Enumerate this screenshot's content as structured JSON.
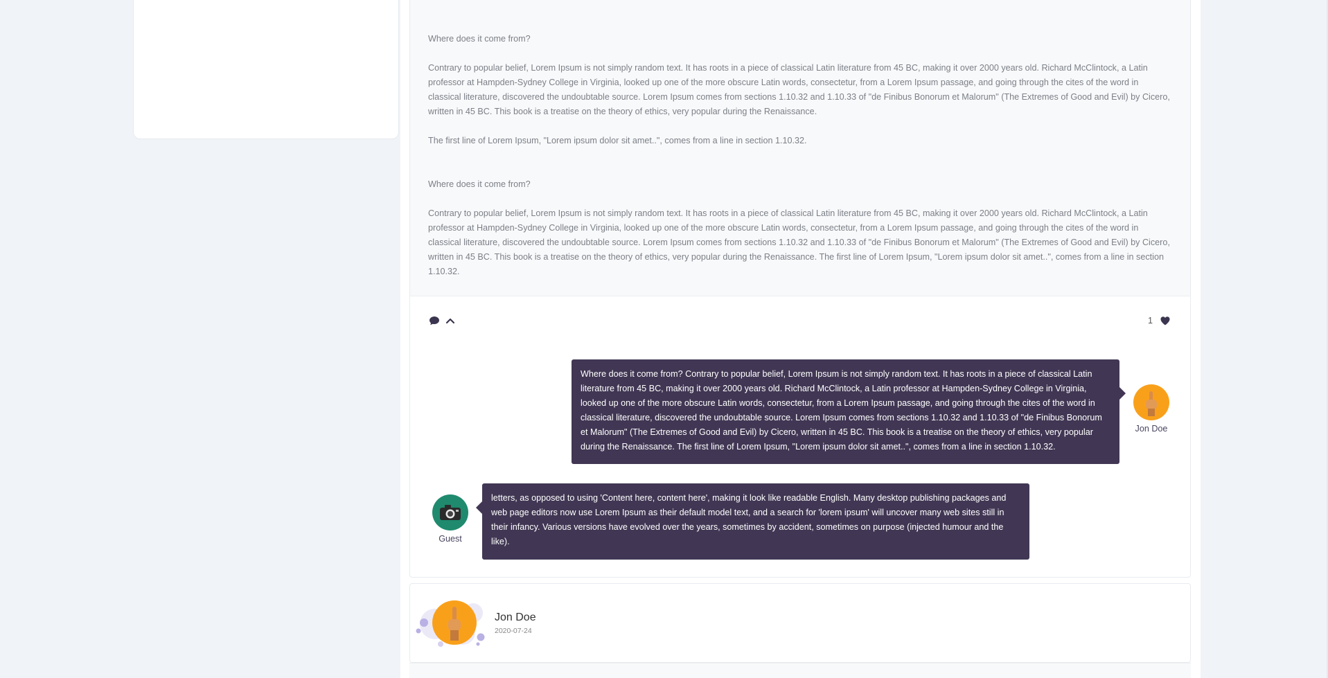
{
  "post": {
    "paragraphs": [
      "Where does it come from?",
      "Contrary to popular belief, Lorem Ipsum is not simply random text. It has roots in a piece of classical Latin literature from 45 BC, making it over 2000 years old. Richard McClintock, a Latin professor at Hampden-Sydney College in Virginia, looked up one of the more obscure Latin words, consectetur, from a Lorem Ipsum passage, and going through the cites of the word in classical literature, discovered the undoubtable source. Lorem Ipsum comes from sections 1.10.32 and 1.10.33 of \"de Finibus Bonorum et Malorum\" (The Extremes of Good and Evil) by Cicero, written in 45 BC. This book is a treatise on the theory of ethics, very popular during the Renaissance.",
      "The first line of Lorem Ipsum, \"Lorem ipsum dolor sit amet..\", comes from a line in section 1.10.32.",
      "Where does it come from?",
      "Contrary to popular belief, Lorem Ipsum is not simply random text. It has roots in a piece of classical Latin literature from 45 BC, making it over 2000 years old. Richard McClintock, a Latin professor at Hampden-Sydney College in Virginia, looked up one of the more obscure Latin words, consectetur, from a Lorem Ipsum passage, and going through the cites of the word in classical literature, discovered the undoubtable source. Lorem Ipsum comes from sections 1.10.32 and 1.10.33 of \"de Finibus Bonorum et Malorum\" (The Extremes of Good and Evil) by Cicero, written in 45 BC. This book is a treatise on the theory of ethics, very popular during the Renaissance. The first line of Lorem Ipsum, \"Lorem ipsum dolor sit amet..\", comes from a line in section 1.10.32."
    ]
  },
  "actions": {
    "comment_icon": "comment-icon",
    "collapse_icon": "chevron-up-icon",
    "like_count": "1",
    "like_icon": "heart-icon"
  },
  "comments": [
    {
      "author": "Jon Doe",
      "text": "Where does it come from? Contrary to popular belief, Lorem Ipsum is not simply random text. It has roots in a piece of classical Latin literature from 45 BC, making it over 2000 years old. Richard McClintock, a Latin professor at Hampden-Sydney College in Virginia, looked up one of the more obscure Latin words, consectetur, from a Lorem Ipsum passage, and going through the cites of the word in classical literature, discovered the undoubtable source. Lorem Ipsum comes from sections 1.10.32 and 1.10.33 of \"de Finibus Bonorum et Malorum\" (The Extremes of Good and Evil) by Cicero, written in 45 BC. This book is a treatise on the theory of ethics, very popular during the Renaissance. The first line of Lorem Ipsum, \"Lorem ipsum dolor sit amet..\", comes from a line in section 1.10.32.",
      "avatar_color": "#f9a01b"
    },
    {
      "author": "Guest",
      "text": "letters, as opposed to using 'Content here, content here', making it look like readable English. Many desktop publishing packages and web page editors now use Lorem Ipsum as their default model text, and a search for 'lorem ipsum' will uncover many web sites still in their infancy. Various versions have evolved over the years, sometimes by accident, sometimes on purpose (injected humour and the like).",
      "avatar_color": "#1f8a6e"
    }
  ],
  "author_card": {
    "name": "Jon Doe",
    "date": "2020-07-24"
  },
  "colors": {
    "bubble_bg": "#413754",
    "accent_orange": "#f9a01b",
    "accent_green": "#1f8a6e",
    "page_bg": "#f0f4f8"
  }
}
